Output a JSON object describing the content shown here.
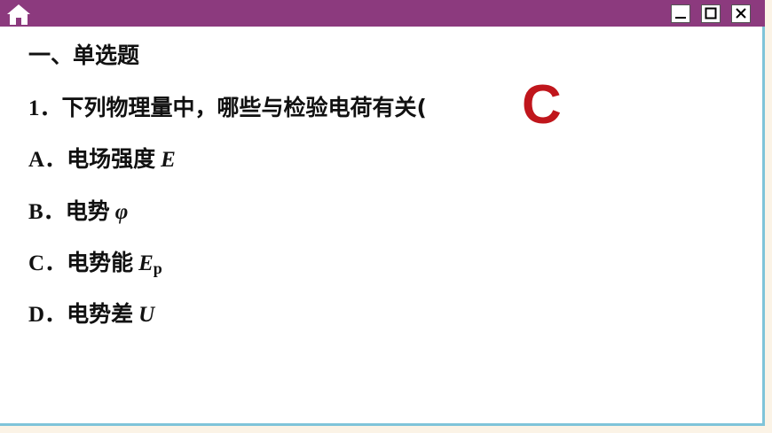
{
  "titlebar": {
    "home_icon": "home-icon",
    "buttons": [
      "minimize-icon",
      "maximize-icon",
      "close-icon"
    ],
    "color": "#8c3a7e"
  },
  "section_title": "一、单选题",
  "question": {
    "number": "1．",
    "text": "下列物理量中，哪些与检验电荷有关(",
    "answer": "C",
    "answer_color": "#c0161c"
  },
  "options": [
    {
      "label": "A．",
      "text": "电场强度",
      "var": "E",
      "sub": ""
    },
    {
      "label": "B．",
      "text": "电势",
      "var": "φ",
      "sub": ""
    },
    {
      "label": "C．",
      "text": "电势能",
      "var": "E",
      "sub": "p"
    },
    {
      "label": "D．",
      "text": "电势差",
      "var": "U",
      "sub": ""
    }
  ]
}
